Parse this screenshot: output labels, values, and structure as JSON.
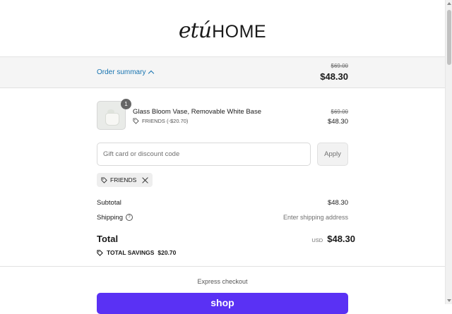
{
  "brand": {
    "script": "etú",
    "word": "HOME"
  },
  "summary": {
    "toggle_label": "Order summary",
    "original_total": "$69.00",
    "total": "$48.30"
  },
  "item": {
    "quantity": "1",
    "name": "Glass Bloom Vase, Removable White Base",
    "discount": "FRIENDS (-$20.70)",
    "original_price": "$69.00",
    "price": "$48.30"
  },
  "discount": {
    "placeholder": "Gift card or discount code",
    "apply_label": "Apply",
    "applied_code": "FRIENDS"
  },
  "totals": {
    "subtotal_label": "Subtotal",
    "subtotal_value": "$48.30",
    "shipping_label": "Shipping",
    "shipping_value": "Enter shipping address",
    "total_label": "Total",
    "currency": "USD",
    "total_value": "$48.30",
    "savings_label": "TOTAL SAVINGS",
    "savings_value": "$20.70"
  },
  "express": {
    "label": "Express checkout",
    "shop_label": "shop"
  },
  "colors": {
    "link": "#1773b0",
    "shop_pay": "#5a31f4"
  }
}
